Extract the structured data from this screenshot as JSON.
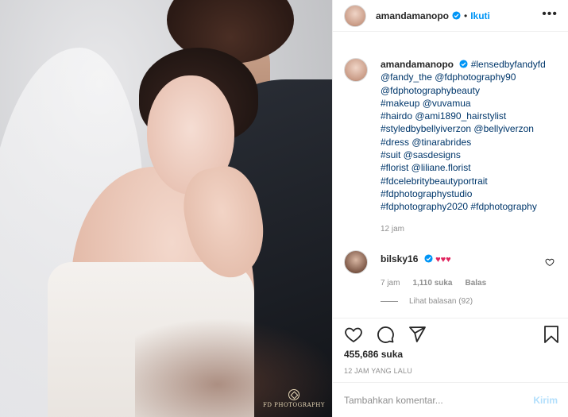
{
  "post": {
    "username": "amandamanopo",
    "follow_label": "Ikuti",
    "dot": "•",
    "more_label": "•••",
    "image_watermark": "FD PHOTOGRAPHY"
  },
  "caption": {
    "username": "amandamanopo",
    "lines": [
      "#lensedbyfandyfd",
      "@fandy_the @fdphotography90",
      "@fdphotographybeauty",
      "#makeup @vuvamua",
      "#hairdo @ami1890_hairstylist",
      "#styledbybellyiverzon @bellyiverzon",
      "#dress @tinarabrides",
      "#suit @sasdesigns",
      "#florist @liliane.florist",
      "#fdcelebritybeautyportrait",
      "#fdphotographystudio",
      "#fdphotography2020 #fdphotography"
    ],
    "time": "12 jam"
  },
  "comment": {
    "username": "bilsky16",
    "text": "♥♥♥",
    "time": "7 jam",
    "likes": "1,110 suka",
    "reply_label": "Balas",
    "view_replies": "Lihat balasan (92)"
  },
  "actions": {
    "likes": "455,686 suka",
    "posted": "12 JAM YANG LALU"
  },
  "comment_input": {
    "placeholder": "Tambahkan komentar...",
    "send_label": "Kirim"
  },
  "colors": {
    "accent": "#0095f6",
    "hashtag": "#00376b",
    "muted": "#8e8e8e",
    "heart": "#e0245e",
    "send_disabled": "#b2dffc"
  },
  "icons": [
    "verified-badge-icon",
    "more-icon",
    "heart-icon",
    "comment-icon",
    "share-icon",
    "bookmark-icon"
  ]
}
